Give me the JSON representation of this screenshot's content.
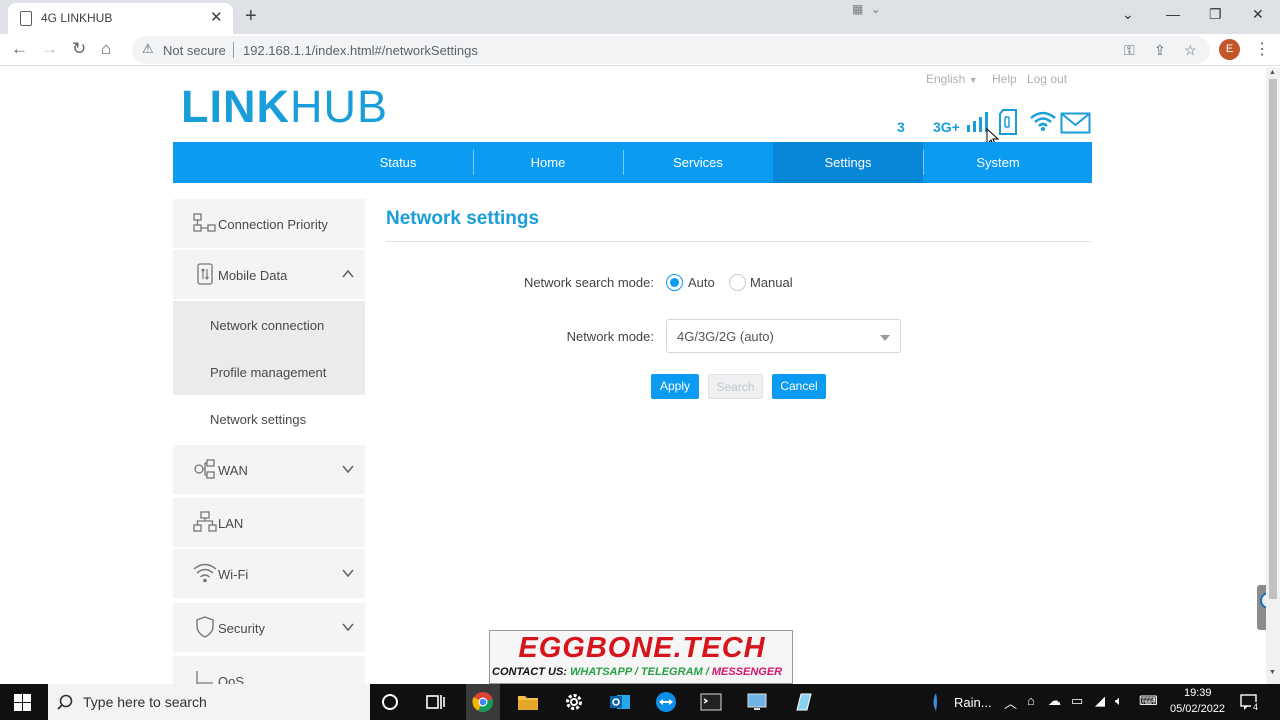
{
  "browser": {
    "tab_title": "4G LINKHUB",
    "tab_close": "✕",
    "new_tab": "+",
    "not_secure": "Not secure",
    "url": "192.168.1.1/index.html#/networkSettings",
    "profile_initial": "E"
  },
  "header": {
    "language": "English",
    "help": "Help",
    "logout": "Log out",
    "logo_bold": "LINK",
    "logo_light": "HUB",
    "signal_count": "3",
    "network_type": "3G+"
  },
  "nav": {
    "items": [
      "Status",
      "Home",
      "Services",
      "Settings",
      "System"
    ],
    "active": "Settings"
  },
  "sidebar": {
    "connection_priority": "Connection Priority",
    "mobile_data": "Mobile Data",
    "network_connection": "Network connection",
    "profile_management": "Profile management",
    "network_settings": "Network settings",
    "wan": "WAN",
    "lan": "LAN",
    "wifi": "Wi-Fi",
    "security": "Security",
    "qos": "QoS"
  },
  "main": {
    "title": "Network settings",
    "search_mode_label": "Network search mode:",
    "search_mode_options": [
      "Auto",
      "Manual"
    ],
    "search_mode_selected": "Auto",
    "network_mode_label": "Network mode:",
    "network_mode_value": "4G/3G/2G (auto)",
    "apply": "Apply",
    "search": "Search",
    "cancel": "Cancel"
  },
  "watermark": {
    "title": "EGGBONE.TECH",
    "contact_prefix": "CONTACT US:",
    "contact_whatsapp": "WHATSAPP / TELEGRAM /",
    "contact_messenger": "MESSENGER"
  },
  "taskbar": {
    "search_placeholder": "Type here to search",
    "weather": "Rain...",
    "time": "19:39",
    "date": "05/02/2022",
    "notifications": "4"
  },
  "colors": {
    "accent": "#1a9ed9",
    "nav_bg": "#0b9bf0",
    "nav_active": "#0887d6"
  }
}
